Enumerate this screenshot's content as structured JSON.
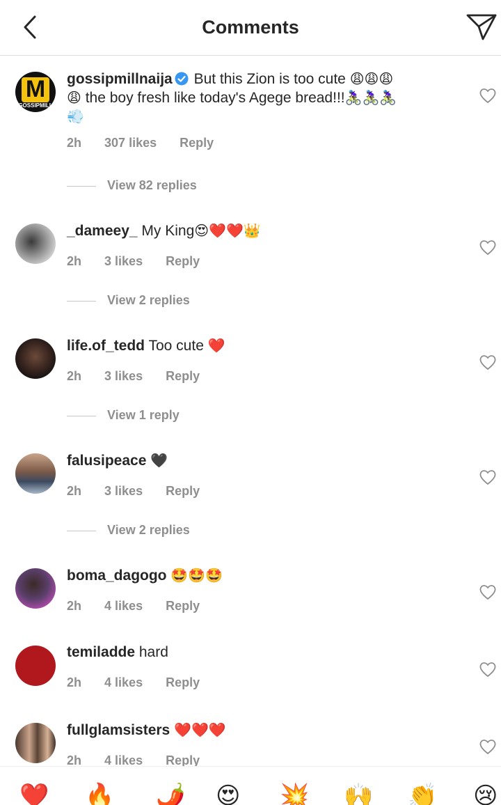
{
  "header": {
    "title": "Comments"
  },
  "colors": {
    "text": "#262626",
    "secondary": "#8e8e8e",
    "verified": "#3897f0",
    "avatar_temiladde": "#b0181e"
  },
  "comments": [
    {
      "username": "gossipmillnaija",
      "verified": true,
      "text_line1": "But this Zion is too cute",
      "emoji1": "😩😩😩",
      "text_line2": "the boy fresh like today's Agege bread!!!",
      "emoji_line2_start": "😩",
      "emoji2": "🚴🏿‍♀️🚴🏿‍♀️🚴🏿‍♀️",
      "emoji3": "💨",
      "time": "2h",
      "likes": "307 likes",
      "reply": "Reply",
      "avatar_text": "M",
      "avatar_subtext": "GOSSIPMILL",
      "view_replies": "View 82 replies"
    },
    {
      "username": "_dameey_",
      "text": "My King",
      "emoji": "😍❤️❤️👑",
      "time": "2h",
      "likes": "3 likes",
      "reply": "Reply",
      "view_replies": "View 2 replies"
    },
    {
      "username": "life.of_tedd",
      "text": "Too cute",
      "emoji": "❤️",
      "time": "2h",
      "likes": "3 likes",
      "reply": "Reply",
      "view_replies": "View 1 reply"
    },
    {
      "username": "falusipeace",
      "text": "",
      "emoji": "🖤",
      "time": "2h",
      "likes": "3 likes",
      "reply": "Reply",
      "view_replies": "View 2 replies"
    },
    {
      "username": "boma_dagogo",
      "text": "",
      "emoji": "🤩🤩🤩",
      "time": "2h",
      "likes": "4 likes",
      "reply": "Reply"
    },
    {
      "username": "temiladde",
      "text": "hard",
      "emoji": "",
      "time": "2h",
      "likes": "4 likes",
      "reply": "Reply"
    },
    {
      "username": "fullglamsisters",
      "text": "",
      "emoji": "❤️❤️❤️",
      "time": "2h",
      "likes": "4 likes",
      "reply": "Reply"
    }
  ],
  "reactions": [
    "❤️",
    "🔥",
    "🌶️",
    "😍",
    "💥",
    "🙌",
    "👏",
    "😢"
  ]
}
